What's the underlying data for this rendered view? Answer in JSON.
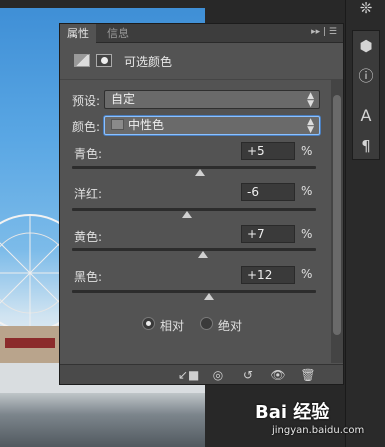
{
  "panel": {
    "tabs": [
      {
        "label": "属性",
        "active": true
      },
      {
        "label": "信息",
        "active": false
      }
    ],
    "title": "可选颜色",
    "preset": {
      "label": "预设:",
      "value": "自定"
    },
    "colors": {
      "label": "颜色:",
      "value": "中性色",
      "swatch_color": "#8a8a8a"
    },
    "sliders": [
      {
        "label": "青色:",
        "value": "+5",
        "unit": "%",
        "level": 5
      },
      {
        "label": "洋红:",
        "value": "-6",
        "unit": "%",
        "level": -6
      },
      {
        "label": "黄色:",
        "value": "+7",
        "unit": "%",
        "level": 7
      },
      {
        "label": "黑色:",
        "value": "+12",
        "unit": "%",
        "level": 12
      }
    ],
    "method": {
      "options": [
        {
          "label": "相对",
          "selected": true
        },
        {
          "label": "绝对",
          "selected": false
        }
      ]
    },
    "footer_icons": [
      "clip-to-layer-icon",
      "visibility-preview-icon",
      "reset-icon",
      "eye-icon",
      "trash-icon"
    ]
  },
  "dock_icons": [
    "brush-settings-icon",
    "3d-cube-icon",
    "info-icon",
    "character-icon",
    "paragraph-icon"
  ],
  "watermark": {
    "text": "Bai 经验",
    "url": "jingyan.baidu.com"
  },
  "colors": {
    "panel_bg": "#535353",
    "focus_ring": "#8cc1ff"
  }
}
